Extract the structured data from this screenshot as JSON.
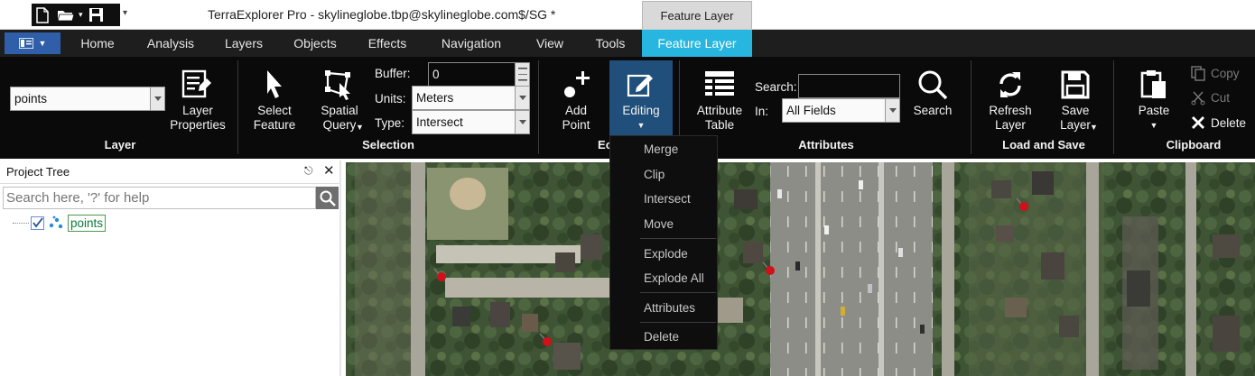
{
  "window": {
    "title": "TerraExplorer Pro - skylineglobe.tbp@skylineglobe.com$/SG *",
    "context_tab_header": "Feature Layer",
    "qat_more": "▾"
  },
  "tabs": [
    {
      "label": "Home"
    },
    {
      "label": "Analysis"
    },
    {
      "label": "Layers"
    },
    {
      "label": "Objects"
    },
    {
      "label": "Effects"
    },
    {
      "label": "Navigation"
    },
    {
      "label": "View"
    },
    {
      "label": "Tools"
    },
    {
      "label": "Feature Layer",
      "active": true
    }
  ],
  "ribbon": {
    "layer_group": {
      "layer_select_value": "points",
      "layer_properties_label": "Layer\nProperties",
      "group_label": "Layer"
    },
    "selection_group": {
      "select_feature_label": "Select\nFeature",
      "spatial_query_label": "Spatial\nQuery",
      "buffer_label": "Buffer:",
      "buffer_value": "0",
      "units_label": "Units:",
      "units_value": "Meters",
      "type_label": "Type:",
      "type_value": "Intersect",
      "group_label": "Selection"
    },
    "edit_group": {
      "add_point_label": "Add\nPoint",
      "editing_label": "Editing",
      "group_label_partial": "Ec"
    },
    "attributes_group": {
      "attribute_table_label": "Attribute\nTable",
      "search_label": "Search:",
      "search_value": "",
      "in_label": "In:",
      "in_value": "All Fields",
      "search_button_label": "Search",
      "group_label": "Attributes"
    },
    "load_save_group": {
      "refresh_layer_label": "Refresh\nLayer",
      "save_layer_label": "Save\nLayer",
      "group_label": "Load and Save"
    },
    "clipboard_group": {
      "paste_label": "Paste",
      "copy_label": "Copy",
      "cut_label": "Cut",
      "delete_label": "Delete",
      "group_label": "Clipboard"
    }
  },
  "editing_menu": {
    "items": [
      {
        "label": "Merge"
      },
      {
        "label": "Clip"
      },
      {
        "label": "Intersect"
      },
      {
        "label": "Move"
      },
      {
        "label": "Explode"
      },
      {
        "label": "Explode All"
      },
      {
        "label": "Attributes"
      },
      {
        "label": "Delete"
      }
    ]
  },
  "project_tree": {
    "title": "Project Tree",
    "search_placeholder": "Search here, '?' for help",
    "nodes": [
      {
        "label": "points",
        "checked": true
      }
    ]
  },
  "colors": {
    "accent_tab": "#26b6df",
    "file_button": "#2f5fa8",
    "ribbon_bg": "#0a0a0a",
    "editing_active_bg": "#1f4f7a",
    "pin_red": "#d0101a"
  }
}
